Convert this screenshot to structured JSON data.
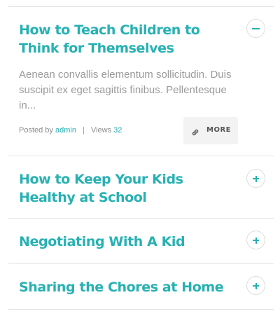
{
  "items": [
    {
      "title": "How to Teach Children to Think for Themselves",
      "expanded": true,
      "toggle_icon": "minus-icon",
      "excerpt": "Aenean convallis elementum sollicitudin. Duis suscipit ex eget sagittis finibus. Pellentesque in...",
      "meta": {
        "posted_by_label": "Posted by",
        "author": "admin",
        "separator": "|",
        "views_label": "Views",
        "views": "32"
      },
      "more_button": {
        "icon": "link-icon",
        "label": "MORE"
      }
    },
    {
      "title": "How to Keep Your Kids Healthy at School",
      "expanded": false,
      "toggle_icon": "plus-icon"
    },
    {
      "title": "Negotiating With A Kid",
      "expanded": false,
      "toggle_icon": "plus-icon"
    },
    {
      "title": "Sharing the Chores at Home",
      "expanded": false,
      "toggle_icon": "plus-icon"
    }
  ],
  "colors": {
    "accent": "#27b1b3",
    "text_muted": "#9a9a9a",
    "divider": "#e3e3e3",
    "button_bg": "#f3f3f3"
  }
}
